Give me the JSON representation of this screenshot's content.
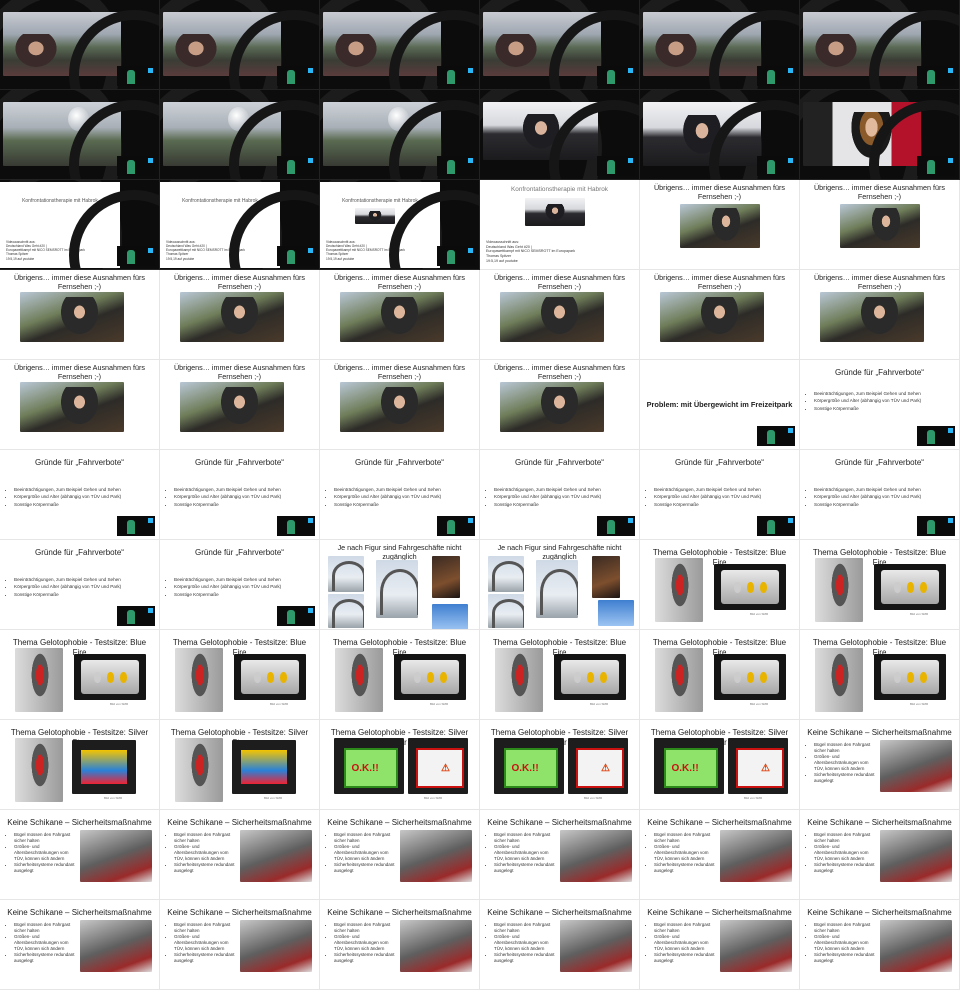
{
  "grid": {
    "columns": 6,
    "rows": 11
  },
  "texts": {
    "konfrontation": "Konfrontationstherapie mit Habrok",
    "konfrontation_foot": [
      "Videoausschnitt aus:",
      "Deutschland Was Geht #20 |",
      "Europawettkampf mit NICO SEMSROTT im Europapark",
      "Thomas Spitzer",
      "19:5,19 auf youtube"
    ],
    "uebrigens": "Übrigens… immer diese Ausnahmen fürs Fernsehen ;-)",
    "problem": "Problem: mit Übergewicht im Freizeitpark",
    "gruende_quote": "Gründe für „Fahrverbote“",
    "gruende": "Gründe für „Fahrverbote“",
    "gruende_bullets": [
      "Beeinträchtigungen, zum Beispiel Gehen und Sehen",
      "Körpergröße und Alter (abhängig von TÜV und Park)",
      "Sonstige Körpermaße"
    ],
    "figur": "Je nach Figur sind Fahrgeschäfte nicht zugänglich",
    "blue_fire": "Thema Gelotophobie - Testsitze: Blue Fire",
    "silver_star": "Thema Gelotophobie - Testsitze: Silver Star",
    "schikane": "Keine Schikane – Sicherheitsmaßnahme",
    "schikane_bullets": [
      "Bügel müssen den Fahrgast sicher halten",
      "Größen- und Altersbeschränkungen vom TÜV, können sich ändern",
      "Sicherheitssysteme redundant ausgelegt"
    ],
    "bild_caption": "Bild von SMR",
    "warn_ok": "O.K.!!",
    "warn_red": "⚠"
  },
  "colors": {
    "dark_bg": "#0c0c0c",
    "accent_blue": "#29b6f6",
    "green_char": "#2e9a6c"
  }
}
